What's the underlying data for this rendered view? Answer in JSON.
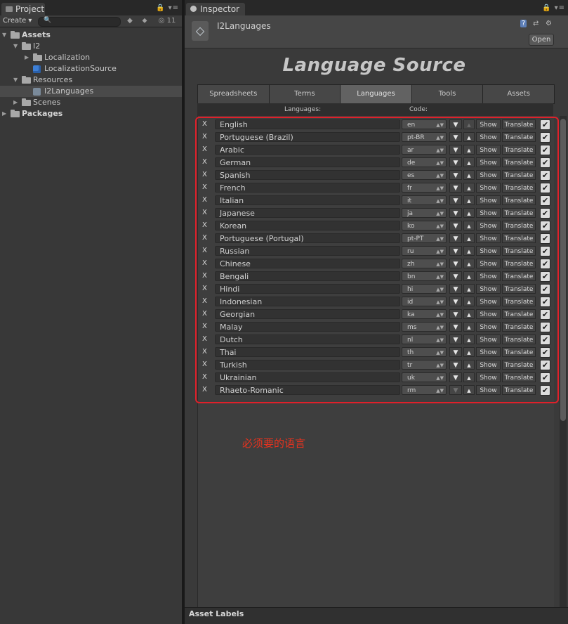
{
  "project": {
    "tab_label": "Project",
    "create_label": "Create",
    "hidden_count": "11",
    "tree": [
      {
        "label": "Assets",
        "indent": 0,
        "expanded": true,
        "icon": "folder",
        "bold": true,
        "selected": false
      },
      {
        "label": "I2",
        "indent": 1,
        "expanded": true,
        "icon": "folder",
        "bold": false,
        "selected": false
      },
      {
        "label": "Localization",
        "indent": 2,
        "expanded": false,
        "icon": "folder",
        "bold": false,
        "selected": false
      },
      {
        "label": "LocalizationSource",
        "indent": 2,
        "expanded": null,
        "icon": "cube",
        "bold": false,
        "selected": false
      },
      {
        "label": "Resources",
        "indent": 1,
        "expanded": true,
        "icon": "folder",
        "bold": false,
        "selected": false
      },
      {
        "label": "I2Languages",
        "indent": 2,
        "expanded": null,
        "icon": "asset",
        "bold": false,
        "selected": true
      },
      {
        "label": "Scenes",
        "indent": 1,
        "expanded": false,
        "icon": "folder",
        "bold": false,
        "selected": false
      },
      {
        "label": "Packages",
        "indent": 0,
        "expanded": false,
        "icon": "folder",
        "bold": true,
        "selected": false
      }
    ]
  },
  "inspector": {
    "tab_label": "Inspector",
    "object_name": "I2Languages",
    "open_label": "Open",
    "title": "Language Source",
    "tabs": [
      "Spreadsheets",
      "Terms",
      "Languages",
      "Tools",
      "Assets"
    ],
    "active_tab": "Languages",
    "col_languages": "Languages:",
    "col_code": "Code:",
    "languages": [
      {
        "name": "English",
        "code": "en"
      },
      {
        "name": "Portuguese (Brazil)",
        "code": "pt-BR"
      },
      {
        "name": "Arabic",
        "code": "ar"
      },
      {
        "name": "German",
        "code": "de"
      },
      {
        "name": "Spanish",
        "code": "es"
      },
      {
        "name": "French",
        "code": "fr"
      },
      {
        "name": "Italian",
        "code": "it"
      },
      {
        "name": "Japanese",
        "code": "ja"
      },
      {
        "name": "Korean",
        "code": "ko"
      },
      {
        "name": "Portuguese (Portugal)",
        "code": "pt-PT"
      },
      {
        "name": "Russian",
        "code": "ru"
      },
      {
        "name": "Chinese",
        "code": "zh"
      },
      {
        "name": "Bengali",
        "code": "bn"
      },
      {
        "name": "Hindi",
        "code": "hi"
      },
      {
        "name": "Indonesian",
        "code": "id"
      },
      {
        "name": "Georgian",
        "code": "ka"
      },
      {
        "name": "Malay",
        "code": "ms"
      },
      {
        "name": "Dutch",
        "code": "nl"
      },
      {
        "name": "Thai",
        "code": "th"
      },
      {
        "name": "Turkish",
        "code": "tr"
      },
      {
        "name": "Ukrainian",
        "code": "uk"
      },
      {
        "name": "Rhaeto-Romanic",
        "code": "rm"
      }
    ],
    "remove_label": "X",
    "move_down_glyph": "▼",
    "move_up_glyph": "▲",
    "show_label": "Show",
    "translate_label": "Translate",
    "annotation": "必须要的语言",
    "highlight_color": "#e0202a"
  },
  "footer": {
    "asset_labels": "Asset Labels"
  }
}
